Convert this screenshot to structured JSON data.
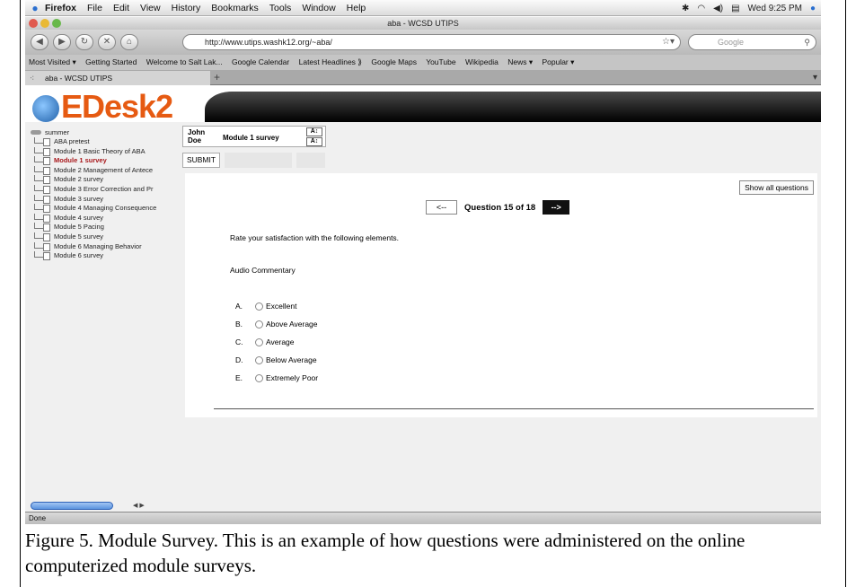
{
  "menubar": {
    "app": "Firefox",
    "menus": [
      "File",
      "Edit",
      "View",
      "History",
      "Bookmarks",
      "Tools",
      "Window",
      "Help"
    ],
    "clock": "Wed 9:25 PM"
  },
  "window": {
    "title": "aba - WCSD UTIPS"
  },
  "navbar": {
    "url": "http://www.utips.washk12.org/~aba/",
    "search_placeholder": "Google"
  },
  "bookmarks": [
    "Most Visited ▾",
    "Getting Started",
    "Welcome to Salt Lak...",
    "Google Calendar",
    "Latest Headlines ⟫",
    "Google Maps",
    "YouTube",
    "Wikipedia",
    "News ▾",
    "Popular ▾"
  ],
  "tab": {
    "label": "aba - WCSD UTIPS",
    "add": "+"
  },
  "logo": {
    "text": "EDesk2"
  },
  "sidebar": {
    "root": "summer",
    "items": [
      "ABA pretest",
      "Module 1 Basic Theory of ABA",
      "Module 1 survey",
      "Module 2 Management of Antece",
      "Module 2 survey",
      "Module 3 Error Correction and Pr",
      "Module 3 survey",
      "Module 4 Managing Consequence",
      "Module 4 survey",
      "Module 5 Pacing",
      "Module 5 survey",
      "Module 6 Managing Behavior",
      "Module 6 survey"
    ],
    "active_index": 2
  },
  "student": {
    "first": "John",
    "last": "Doe",
    "module": "Module 1 survey"
  },
  "submit_label": "SUBMIT",
  "question": {
    "show_all": "Show all questions",
    "prev": "<--",
    "next": "-->",
    "counter": "Question 15 of 18",
    "prompt": "Rate your satisfaction with the following elements.",
    "element": "Audio Commentary",
    "options": [
      {
        "letter": "A.",
        "label": "Excellent"
      },
      {
        "letter": "B.",
        "label": "Above Average"
      },
      {
        "letter": "C.",
        "label": "Average"
      },
      {
        "letter": "D.",
        "label": "Below Average"
      },
      {
        "letter": "E.",
        "label": "Extremely Poor"
      }
    ]
  },
  "status": "Done",
  "caption": "Figure 5. Module Survey.  This is an example of how questions were administered on the online computerized module surveys."
}
